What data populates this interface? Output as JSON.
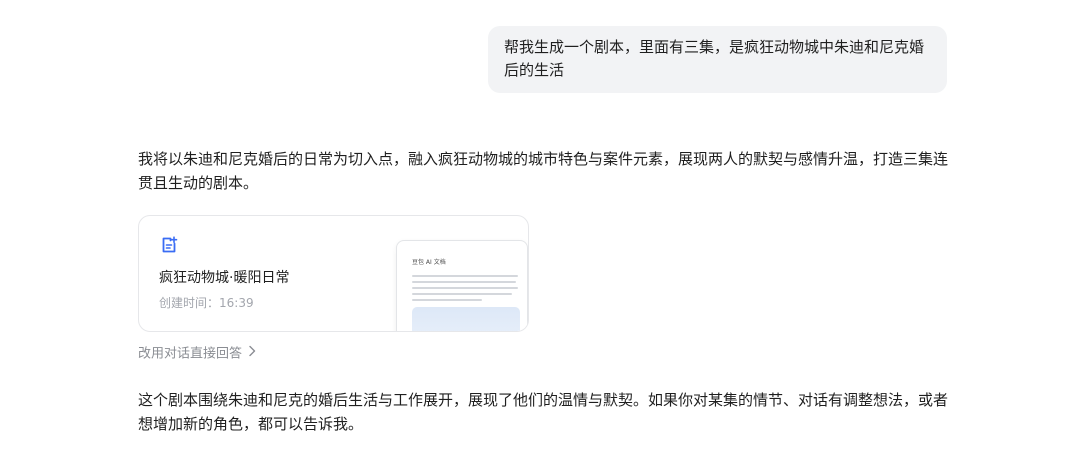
{
  "user_message": {
    "text": "帮我生成一个剧本，里面有三集，是疯狂动物城中朱迪和尼克婚后的生活"
  },
  "assistant": {
    "intro": "我将以朱迪和尼克婚后的日常为切入点，融入疯狂动物城的城市特色与案件元素，展现两人的默契与感情升温，打造三集连贯且生动的剧本。",
    "document_card": {
      "icon": "document-ai-icon",
      "title": "疯狂动物城·暖阳日常",
      "created_time": "创建时间：16:39",
      "preview_title": "豆包 AI 文档"
    },
    "switch_link": "改用对话直接回答",
    "outro": "这个剧本围绕朱迪和尼克的婚后生活与工作展开，展现了他们的温情与默契。如果你对某集的情节、对话有调整想法，或者想增加新的角色，都可以告诉我。"
  },
  "colors": {
    "bubble_bg": "#f2f3f5",
    "accent": "#3a6cf4",
    "muted_text": "#8a8d93"
  }
}
